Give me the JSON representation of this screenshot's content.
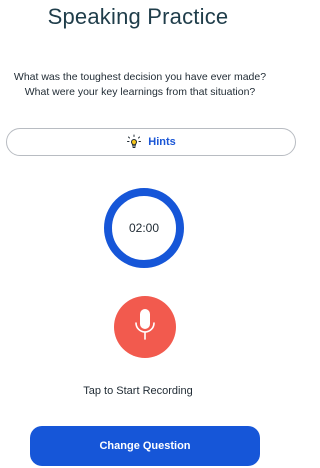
{
  "header": {
    "title": "Speaking Practice"
  },
  "question": {
    "line1": "What was the toughest decision you have ever made?",
    "line2": "What were your key learnings from that situation?"
  },
  "hints": {
    "label": "Hints",
    "icon": "lightbulb-icon"
  },
  "timer": {
    "value": "02:00",
    "ring_color": "#1656d8"
  },
  "record": {
    "icon": "microphone-icon",
    "color": "#f25a4e",
    "label": "Tap to Start Recording"
  },
  "actions": {
    "change_question_label": "Change Question",
    "color": "#1656d8"
  }
}
